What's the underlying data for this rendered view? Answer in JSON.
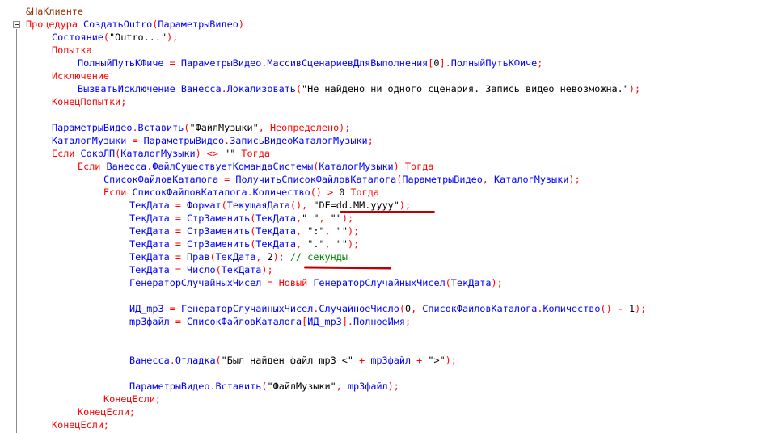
{
  "editor": {
    "lines": [
      [
        {
          "c": "pre",
          "t": "&НаКлиенте"
        }
      ],
      [
        {
          "c": "kw",
          "t": "Процедура "
        },
        {
          "c": "id",
          "t": "СоздатьOutro"
        },
        {
          "c": "op",
          "t": "("
        },
        {
          "c": "id",
          "t": "ПараметрыВидео"
        },
        {
          "c": "op",
          "t": ")"
        }
      ],
      [
        {
          "c": "id",
          "t": "Состояние"
        },
        {
          "c": "op",
          "t": "("
        },
        {
          "c": "str",
          "t": "\"Outro...\""
        },
        {
          "c": "op",
          "t": ");"
        }
      ],
      [
        {
          "c": "kw",
          "t": "Попытка"
        }
      ],
      [
        {
          "c": "id",
          "t": "ПолныйПутьКФиче "
        },
        {
          "c": "op",
          "t": "= "
        },
        {
          "c": "id",
          "t": "ПараметрыВидео"
        },
        {
          "c": "op",
          "t": "."
        },
        {
          "c": "id",
          "t": "МассивСценариевДляВыполнения"
        },
        {
          "c": "op",
          "t": "["
        },
        {
          "c": "plain",
          "t": "0"
        },
        {
          "c": "op",
          "t": "]."
        },
        {
          "c": "id",
          "t": "ПолныйПутьКФиче"
        },
        {
          "c": "op",
          "t": ";"
        }
      ],
      [
        {
          "c": "kw",
          "t": "Исключение"
        }
      ],
      [
        {
          "c": "id",
          "t": "ВызватьИсключение "
        },
        {
          "c": "id",
          "t": "Ванесса"
        },
        {
          "c": "op",
          "t": "."
        },
        {
          "c": "id",
          "t": "Локализовать"
        },
        {
          "c": "op",
          "t": "("
        },
        {
          "c": "str",
          "t": "\"Не найдено ни одного сценария. Запись видео невозможна.\""
        },
        {
          "c": "op",
          "t": ");"
        }
      ],
      [
        {
          "c": "kw",
          "t": "КонецПопытки"
        },
        {
          "c": "op",
          "t": ";"
        }
      ],
      [],
      [
        {
          "c": "id",
          "t": "ПараметрыВидео"
        },
        {
          "c": "op",
          "t": "."
        },
        {
          "c": "id",
          "t": "Вставить"
        },
        {
          "c": "op",
          "t": "("
        },
        {
          "c": "str",
          "t": "\"ФайлМузыки\""
        },
        {
          "c": "op",
          "t": ", "
        },
        {
          "c": "kw",
          "t": "Неопределено"
        },
        {
          "c": "op",
          "t": ");"
        }
      ],
      [
        {
          "c": "id",
          "t": "КаталогМузыки "
        },
        {
          "c": "op",
          "t": "= "
        },
        {
          "c": "id",
          "t": "ПараметрыВидео"
        },
        {
          "c": "op",
          "t": "."
        },
        {
          "c": "id",
          "t": "ЗаписьВидеоКаталогМузыки"
        },
        {
          "c": "op",
          "t": ";"
        }
      ],
      [
        {
          "c": "kw",
          "t": "Если "
        },
        {
          "c": "id",
          "t": "СокрЛП"
        },
        {
          "c": "op",
          "t": "("
        },
        {
          "c": "id",
          "t": "КаталогМузыки"
        },
        {
          "c": "op",
          "t": ") <> "
        },
        {
          "c": "str",
          "t": "\"\""
        },
        {
          "c": "kw",
          "t": " Тогда"
        }
      ],
      [
        {
          "c": "kw",
          "t": "Если "
        },
        {
          "c": "id",
          "t": "Ванесса"
        },
        {
          "c": "op",
          "t": "."
        },
        {
          "c": "id",
          "t": "ФайлСуществуетКомандаСистемы"
        },
        {
          "c": "op",
          "t": "("
        },
        {
          "c": "id",
          "t": "КаталогМузыки"
        },
        {
          "c": "op",
          "t": ")"
        },
        {
          "c": "kw",
          "t": " Тогда"
        }
      ],
      [
        {
          "c": "id",
          "t": "СписокФайловКаталога "
        },
        {
          "c": "op",
          "t": "= "
        },
        {
          "c": "id",
          "t": "ПолучитьСписокФайловКаталога"
        },
        {
          "c": "op",
          "t": "("
        },
        {
          "c": "id",
          "t": "ПараметрыВидео"
        },
        {
          "c": "op",
          "t": ", "
        },
        {
          "c": "id",
          "t": "КаталогМузыки"
        },
        {
          "c": "op",
          "t": ");"
        }
      ],
      [
        {
          "c": "kw",
          "t": "Если "
        },
        {
          "c": "id",
          "t": "СписокФайловКаталога"
        },
        {
          "c": "op",
          "t": "."
        },
        {
          "c": "id",
          "t": "Количество"
        },
        {
          "c": "op",
          "t": "() > "
        },
        {
          "c": "plain",
          "t": "0"
        },
        {
          "c": "kw",
          "t": " Тогда"
        }
      ],
      [
        {
          "c": "id",
          "t": "ТекДата "
        },
        {
          "c": "op",
          "t": "= "
        },
        {
          "c": "id",
          "t": "Формат"
        },
        {
          "c": "op",
          "t": "("
        },
        {
          "c": "id",
          "t": "ТекущаяДата"
        },
        {
          "c": "op",
          "t": "(), "
        },
        {
          "c": "str",
          "t": "\"DF=dd.MM.yyyy\""
        },
        {
          "c": "op",
          "t": ");"
        }
      ],
      [
        {
          "c": "id",
          "t": "ТекДата "
        },
        {
          "c": "op",
          "t": "= "
        },
        {
          "c": "id",
          "t": "СтрЗаменить"
        },
        {
          "c": "op",
          "t": "("
        },
        {
          "c": "id",
          "t": "ТекДата"
        },
        {
          "c": "op",
          "t": ","
        },
        {
          "c": "str",
          "t": "\" \""
        },
        {
          "c": "op",
          "t": ", "
        },
        {
          "c": "str",
          "t": "\"\""
        },
        {
          "c": "op",
          "t": ");"
        }
      ],
      [
        {
          "c": "id",
          "t": "ТекДата "
        },
        {
          "c": "op",
          "t": "= "
        },
        {
          "c": "id",
          "t": "СтрЗаменить"
        },
        {
          "c": "op",
          "t": "("
        },
        {
          "c": "id",
          "t": "ТекДата"
        },
        {
          "c": "op",
          "t": ", "
        },
        {
          "c": "str",
          "t": "\":\""
        },
        {
          "c": "op",
          "t": ", "
        },
        {
          "c": "str",
          "t": "\"\""
        },
        {
          "c": "op",
          "t": ");"
        }
      ],
      [
        {
          "c": "id",
          "t": "ТекДата "
        },
        {
          "c": "op",
          "t": "= "
        },
        {
          "c": "id",
          "t": "СтрЗаменить"
        },
        {
          "c": "op",
          "t": "("
        },
        {
          "c": "id",
          "t": "ТекДата"
        },
        {
          "c": "op",
          "t": ", "
        },
        {
          "c": "str",
          "t": "\".\""
        },
        {
          "c": "op",
          "t": ", "
        },
        {
          "c": "str",
          "t": "\"\""
        },
        {
          "c": "op",
          "t": ");"
        }
      ],
      [
        {
          "c": "id",
          "t": "ТекДата "
        },
        {
          "c": "op",
          "t": "= "
        },
        {
          "c": "id",
          "t": "Прав"
        },
        {
          "c": "op",
          "t": "("
        },
        {
          "c": "id",
          "t": "ТекДата"
        },
        {
          "c": "op",
          "t": ", "
        },
        {
          "c": "plain",
          "t": "2"
        },
        {
          "c": "op",
          "t": "); "
        },
        {
          "c": "cmt",
          "t": "// секунды"
        }
      ],
      [
        {
          "c": "id",
          "t": "ТекДата "
        },
        {
          "c": "op",
          "t": "= "
        },
        {
          "c": "id",
          "t": "Число"
        },
        {
          "c": "op",
          "t": "("
        },
        {
          "c": "id",
          "t": "ТекДата"
        },
        {
          "c": "op",
          "t": ");"
        }
      ],
      [
        {
          "c": "id",
          "t": "ГенераторСлучайныхЧисел "
        },
        {
          "c": "op",
          "t": "= "
        },
        {
          "c": "kw",
          "t": "Новый "
        },
        {
          "c": "id",
          "t": "ГенераторСлучайныхЧисел"
        },
        {
          "c": "op",
          "t": "("
        },
        {
          "c": "id",
          "t": "ТекДата"
        },
        {
          "c": "op",
          "t": ");"
        }
      ],
      [],
      [
        {
          "c": "id",
          "t": "ИД_mp3 "
        },
        {
          "c": "op",
          "t": "= "
        },
        {
          "c": "id",
          "t": "ГенераторСлучайныхЧисел"
        },
        {
          "c": "op",
          "t": "."
        },
        {
          "c": "id",
          "t": "СлучайноеЧисло"
        },
        {
          "c": "op",
          "t": "("
        },
        {
          "c": "plain",
          "t": "0"
        },
        {
          "c": "op",
          "t": ", "
        },
        {
          "c": "id",
          "t": "СписокФайловКаталога"
        },
        {
          "c": "op",
          "t": "."
        },
        {
          "c": "id",
          "t": "Количество"
        },
        {
          "c": "op",
          "t": "() - "
        },
        {
          "c": "plain",
          "t": "1"
        },
        {
          "c": "op",
          "t": ");"
        }
      ],
      [
        {
          "c": "id",
          "t": "mp3файл "
        },
        {
          "c": "op",
          "t": "= "
        },
        {
          "c": "id",
          "t": "СписокФайловКаталога"
        },
        {
          "c": "op",
          "t": "["
        },
        {
          "c": "id",
          "t": "ИД_mp3"
        },
        {
          "c": "op",
          "t": "]."
        },
        {
          "c": "id",
          "t": "ПолноеИмя"
        },
        {
          "c": "op",
          "t": ";"
        }
      ],
      [],
      [],
      [
        {
          "c": "id",
          "t": "Ванесса"
        },
        {
          "c": "op",
          "t": "."
        },
        {
          "c": "id",
          "t": "Отладка"
        },
        {
          "c": "op",
          "t": "("
        },
        {
          "c": "str",
          "t": "\"Был найден файл mp3 <\""
        },
        {
          "c": "op",
          "t": " + "
        },
        {
          "c": "id",
          "t": "mp3файл"
        },
        {
          "c": "op",
          "t": " + "
        },
        {
          "c": "str",
          "t": "\">\""
        },
        {
          "c": "op",
          "t": ");"
        }
      ],
      [],
      [
        {
          "c": "id",
          "t": "ПараметрыВидео"
        },
        {
          "c": "op",
          "t": "."
        },
        {
          "c": "id",
          "t": "Вставить"
        },
        {
          "c": "op",
          "t": "("
        },
        {
          "c": "str",
          "t": "\"ФайлМузыки\""
        },
        {
          "c": "op",
          "t": ", "
        },
        {
          "c": "id",
          "t": "mp3файл"
        },
        {
          "c": "op",
          "t": ");"
        }
      ],
      [
        {
          "c": "kw",
          "t": "КонецЕсли"
        },
        {
          "c": "op",
          "t": ";"
        }
      ],
      [
        {
          "c": "kw",
          "t": "КонецЕсли"
        },
        {
          "c": "op",
          "t": ";"
        }
      ],
      [
        {
          "c": "kw",
          "t": "КонецЕсли"
        },
        {
          "c": "op",
          "t": ";"
        }
      ]
    ]
  },
  "colors": {
    "keyword": "#ff0000",
    "identifier": "#0000ff",
    "string": "#000000",
    "comment": "#008000",
    "preprocessor": "#963200",
    "annotation_underline": "#c00000"
  }
}
